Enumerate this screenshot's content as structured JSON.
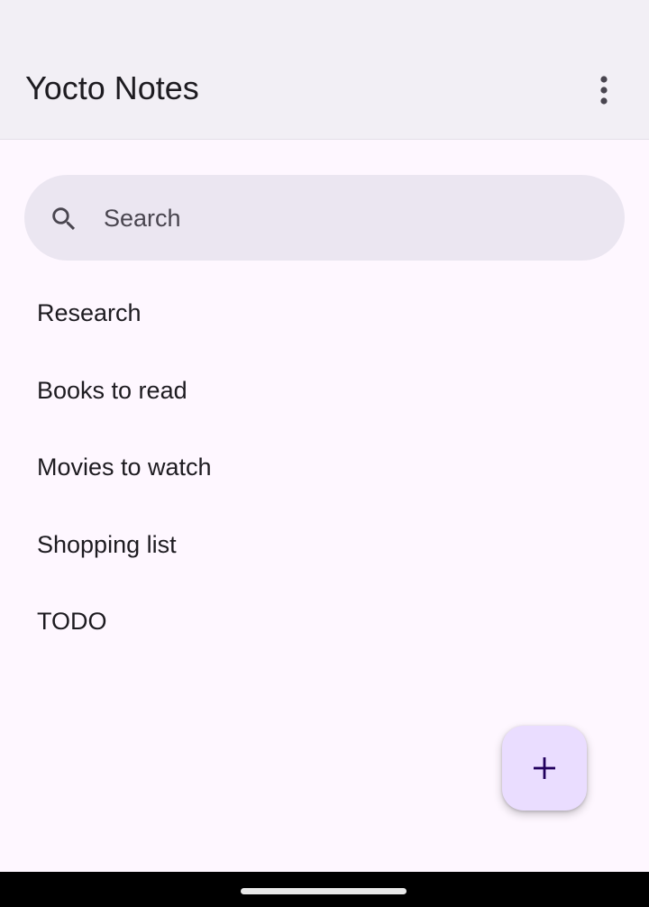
{
  "app_bar": {
    "title": "Yocto Notes",
    "overflow_icon": "more-vert-icon"
  },
  "search": {
    "placeholder": "Search",
    "value": "",
    "icon": "search-icon"
  },
  "notes": [
    {
      "title": "Research"
    },
    {
      "title": "Books to read"
    },
    {
      "title": "Movies to watch"
    },
    {
      "title": "Shopping list"
    },
    {
      "title": "TODO"
    }
  ],
  "fab": {
    "icon": "add-icon"
  },
  "colors": {
    "background": "#fef7ff",
    "app_bar": "#f2eff5",
    "search_bar": "#ebe6f1",
    "fab": "#eaddff",
    "fab_icon": "#21005d",
    "text": "#1d1b20"
  }
}
